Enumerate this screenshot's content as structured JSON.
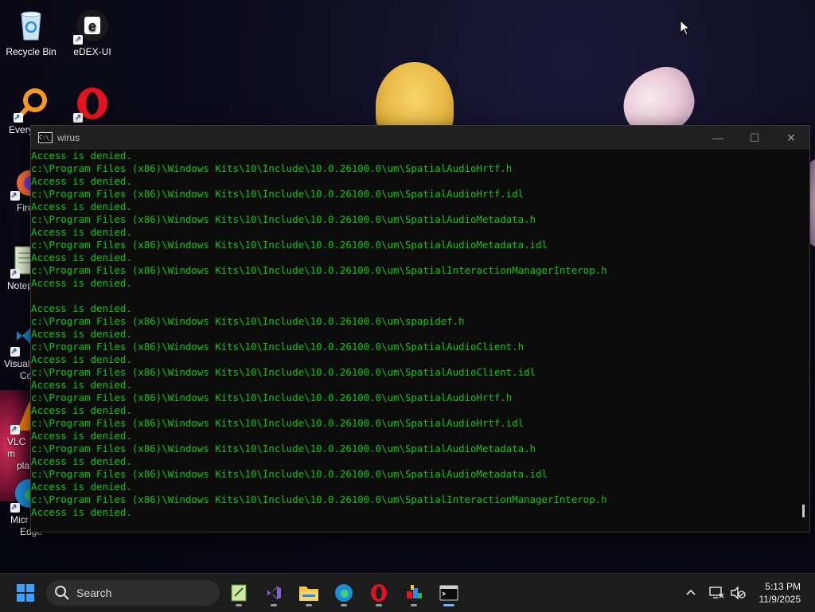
{
  "desktop": {
    "icons": [
      {
        "label": "Recycle Bin"
      },
      {
        "label": "eDEX-UI"
      },
      {
        "label": "Every"
      },
      {
        "label": "Fire"
      },
      {
        "label": "Notep"
      },
      {
        "label": "Visual"
      },
      {
        "label": "Co"
      },
      {
        "label": "VLC m"
      },
      {
        "label": "pla"
      },
      {
        "label": "Micr"
      },
      {
        "label": "Edge"
      }
    ]
  },
  "window": {
    "title": "wirus",
    "icon_text": "C:\\_",
    "minimize": "—",
    "maximize": "☐",
    "close": "✕"
  },
  "console": {
    "lines": [
      "Access is denied.",
      "c:\\Program Files (x86)\\Windows Kits\\10\\Include\\10.0.26100.0\\um\\SpatialAudioHrtf.h",
      "Access is denied.",
      "c:\\Program Files (x86)\\Windows Kits\\10\\Include\\10.0.26100.0\\um\\SpatialAudioHrtf.idl",
      "Access is denied.",
      "c:\\Program Files (x86)\\Windows Kits\\10\\Include\\10.0.26100.0\\um\\SpatialAudioMetadata.h",
      "Access is denied.",
      "c:\\Program Files (x86)\\Windows Kits\\10\\Include\\10.0.26100.0\\um\\SpatialAudioMetadata.idl",
      "Access is denied.",
      "c:\\Program Files (x86)\\Windows Kits\\10\\Include\\10.0.26100.0\\um\\SpatialInteractionManagerInterop.h",
      "Access is denied.",
      "",
      "Access is denied.",
      "c:\\Program Files (x86)\\Windows Kits\\10\\Include\\10.0.26100.0\\um\\spapidef.h",
      "Access is denied.",
      "c:\\Program Files (x86)\\Windows Kits\\10\\Include\\10.0.26100.0\\um\\SpatialAudioClient.h",
      "Access is denied.",
      "c:\\Program Files (x86)\\Windows Kits\\10\\Include\\10.0.26100.0\\um\\SpatialAudioClient.idl",
      "Access is denied.",
      "c:\\Program Files (x86)\\Windows Kits\\10\\Include\\10.0.26100.0\\um\\SpatialAudioHrtf.h",
      "Access is denied.",
      "c:\\Program Files (x86)\\Windows Kits\\10\\Include\\10.0.26100.0\\um\\SpatialAudioHrtf.idl",
      "Access is denied.",
      "c:\\Program Files (x86)\\Windows Kits\\10\\Include\\10.0.26100.0\\um\\SpatialAudioMetadata.h",
      "Access is denied.",
      "c:\\Program Files (x86)\\Windows Kits\\10\\Include\\10.0.26100.0\\um\\SpatialAudioMetadata.idl",
      "Access is denied.",
      "c:\\Program Files (x86)\\Windows Kits\\10\\Include\\10.0.26100.0\\um\\SpatialInteractionManagerInterop.h",
      "Access is denied."
    ],
    "text_color": "#13c513"
  },
  "taskbar": {
    "search_label": "Search",
    "apps": [
      "start-icon",
      "notepad-icon",
      "visual-studio-icon",
      "file-explorer-icon",
      "edge-icon",
      "opera-icon",
      "paint-app-icon",
      "terminal-icon"
    ],
    "time": "5:13 PM",
    "date": "11/9/2025"
  }
}
